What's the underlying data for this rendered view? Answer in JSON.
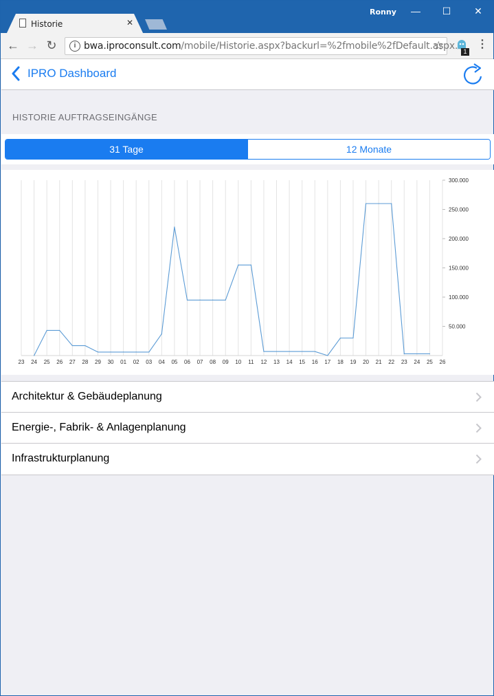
{
  "browser": {
    "user": "Ronny",
    "tab_title": "Historie",
    "url_host": "bwa.iproconsult.com",
    "url_path": "/mobile/Historie.aspx?backurl=%2fmobile%2fDefault.aspx...",
    "extension_badge": "1",
    "icons": {
      "back": "arrow-left-icon",
      "forward": "arrow-right-icon",
      "reload": "reload-icon",
      "info": "info-icon",
      "star": "star-icon",
      "menu": "more-vertical-icon",
      "minimize": "minimize-icon",
      "maximize": "maximize-icon",
      "close": "close-icon"
    }
  },
  "app": {
    "back_label": "IPRO Dashboard",
    "section_title": "HISTORIE AUFTRAGSEINGÄNGE",
    "segments": [
      {
        "label": "31 Tage",
        "active": true
      },
      {
        "label": "12 Monate",
        "active": false
      }
    ],
    "accent_color": "#1a7cf0",
    "list": [
      {
        "label": "Architektur & Gebäudeplanung"
      },
      {
        "label": "Energie-, Fabrik- & Anlagenplanung"
      },
      {
        "label": "Infrastrukturplanung"
      }
    ]
  },
  "chart_data": {
    "type": "line",
    "title": "",
    "xlabel": "",
    "ylabel": "",
    "ylim": [
      0,
      300000
    ],
    "grid": "vertical",
    "yticks": [
      "50.000",
      "100.000",
      "150.000",
      "200.000",
      "250.000",
      "300.000"
    ],
    "ytick_values": [
      50000,
      100000,
      150000,
      200000,
      250000,
      300000
    ],
    "categories": [
      "23",
      "24",
      "25",
      "26",
      "27",
      "28",
      "29",
      "30",
      "01",
      "02",
      "03",
      "04",
      "05",
      "06",
      "07",
      "08",
      "09",
      "10",
      "11",
      "12",
      "13",
      "14",
      "15",
      "16",
      "17",
      "18",
      "19",
      "20",
      "21",
      "22",
      "23",
      "24",
      "25",
      "26"
    ],
    "series": [
      {
        "color": "#5b9bd5",
        "values": [
          null,
          0,
          43000,
          43000,
          17000,
          17000,
          6000,
          6000,
          6000,
          6000,
          6000,
          37000,
          220000,
          95000,
          95000,
          95000,
          95000,
          155000,
          155000,
          7000,
          7000,
          7000,
          7000,
          7000,
          0,
          30000,
          30000,
          260000,
          260000,
          260000,
          3000,
          3000,
          3000,
          null
        ]
      }
    ]
  }
}
